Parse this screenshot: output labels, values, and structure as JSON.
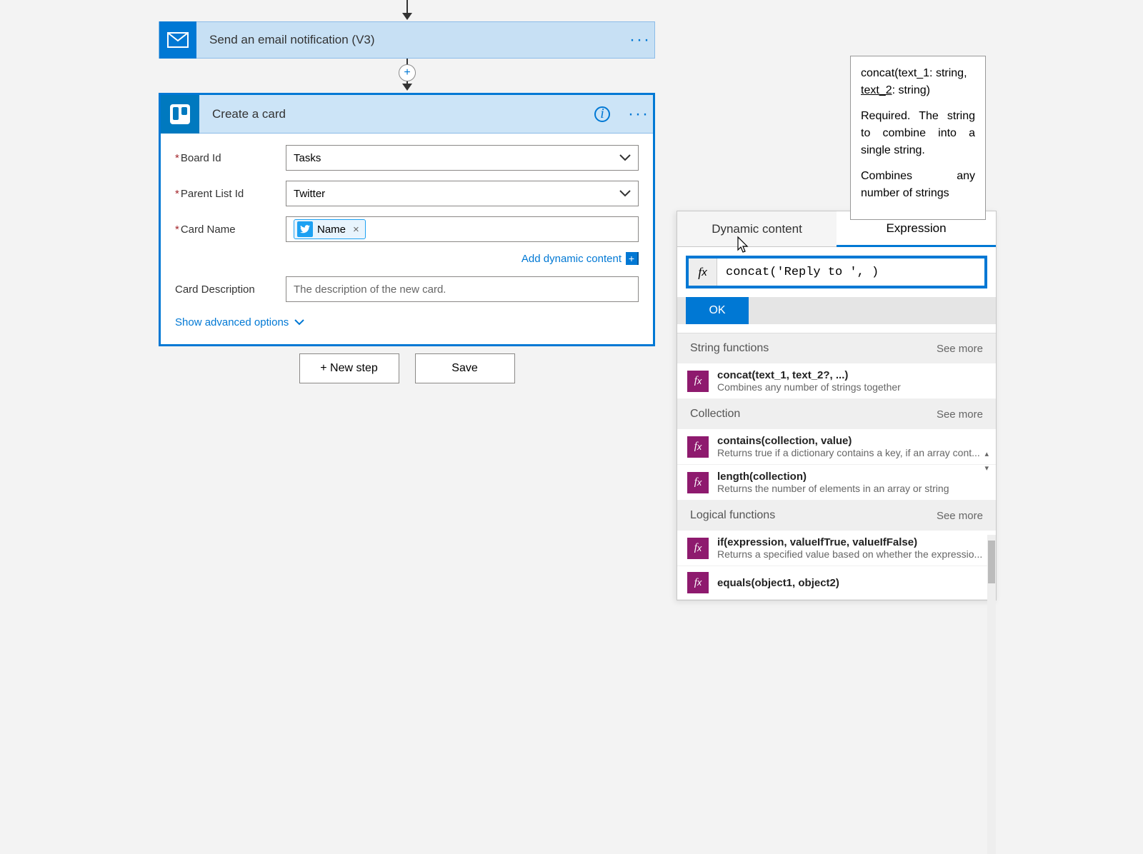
{
  "flow": {
    "emailAction": {
      "title": "Send an email notification (V3)"
    },
    "createCard": {
      "title": "Create a card",
      "fields": {
        "boardId": {
          "label": "Board Id",
          "value": "Tasks"
        },
        "parentListId": {
          "label": "Parent List Id",
          "value": "Twitter"
        },
        "cardName": {
          "label": "Card Name",
          "tokenLabel": "Name"
        },
        "cardDescription": {
          "label": "Card Description",
          "placeholder": "The description of the new card."
        }
      },
      "addDynamic": "Add dynamic content",
      "showAdvanced": "Show advanced options"
    },
    "newStep": "+ New step",
    "save": "Save"
  },
  "exprPanel": {
    "tabs": {
      "dynamic": "Dynamic content",
      "expression": "Expression"
    },
    "inputValue": "concat('Reply to ', )",
    "ok": "OK",
    "sections": {
      "string": {
        "header": "String functions",
        "seeMore": "See more",
        "items": [
          {
            "name": "concat(text_1, text_2?, ...)",
            "desc": "Combines any number of strings together"
          }
        ]
      },
      "collection": {
        "header": "Collection",
        "seeMore": "See more",
        "items": [
          {
            "name": "contains(collection, value)",
            "desc": "Returns true if a dictionary contains a key, if an array cont..."
          },
          {
            "name": "length(collection)",
            "desc": "Returns the number of elements in an array or string"
          }
        ]
      },
      "logical": {
        "header": "Logical functions",
        "seeMore": "See more",
        "items": [
          {
            "name": "if(expression, valueIfTrue, valueIfFalse)",
            "desc": "Returns a specified value based on whether the expressio..."
          },
          {
            "name": "equals(object1, object2)",
            "desc": ""
          }
        ]
      }
    }
  },
  "tooltip": {
    "sigPre": "concat(text_1: string, ",
    "sigParam": "text_2",
    "sigPost": ": string)",
    "desc1": "Required. The string to combine into a single string.",
    "desc2": "Combines any number of strings"
  }
}
